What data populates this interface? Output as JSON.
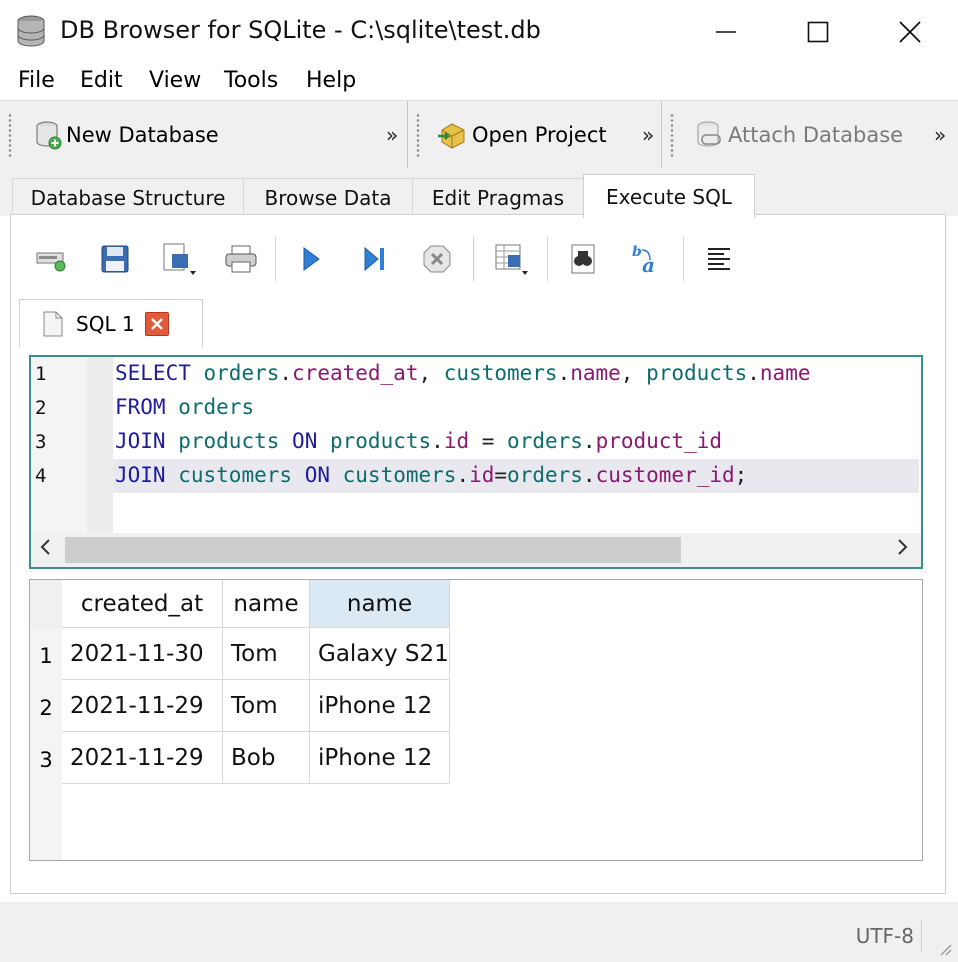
{
  "window": {
    "title": "DB Browser for SQLite - C:\\sqlite\\test.db"
  },
  "menu": [
    {
      "label": "File"
    },
    {
      "label": "Edit"
    },
    {
      "label": "View"
    },
    {
      "label": "Tools"
    },
    {
      "label": "Help"
    }
  ],
  "toolbar": {
    "new_database": "New Database",
    "open_project": "Open Project",
    "attach_database": "Attach Database",
    "more": "»"
  },
  "tabs": [
    {
      "label": "Database Structure"
    },
    {
      "label": "Browse Data"
    },
    {
      "label": "Edit Pragmas"
    },
    {
      "label": "Execute SQL"
    }
  ],
  "sql_tab": {
    "label": "SQL 1"
  },
  "editor": {
    "line_numbers": [
      "1",
      "2",
      "3",
      "4"
    ],
    "lines": [
      [
        [
          "kw",
          "SELECT"
        ],
        [
          "pn",
          " "
        ],
        [
          "id",
          "orders"
        ],
        [
          "pn",
          "."
        ],
        [
          "fld",
          "created_at"
        ],
        [
          "pn",
          ", "
        ],
        [
          "id",
          "customers"
        ],
        [
          "pn",
          "."
        ],
        [
          "fld",
          "name"
        ],
        [
          "pn",
          ", "
        ],
        [
          "id",
          "products"
        ],
        [
          "pn",
          "."
        ],
        [
          "fld",
          "name"
        ]
      ],
      [
        [
          "kw",
          "FROM"
        ],
        [
          "pn",
          " "
        ],
        [
          "id",
          "orders"
        ]
      ],
      [
        [
          "kw",
          "JOIN"
        ],
        [
          "pn",
          " "
        ],
        [
          "id",
          "products"
        ],
        [
          "pn",
          " "
        ],
        [
          "kw",
          "ON"
        ],
        [
          "pn",
          " "
        ],
        [
          "id",
          "products"
        ],
        [
          "pn",
          "."
        ],
        [
          "fld",
          "id"
        ],
        [
          "pn",
          " = "
        ],
        [
          "id",
          "orders"
        ],
        [
          "pn",
          "."
        ],
        [
          "fld",
          "product_id"
        ]
      ],
      [
        [
          "kw",
          "JOIN"
        ],
        [
          "pn",
          " "
        ],
        [
          "id",
          "customers"
        ],
        [
          "pn",
          " "
        ],
        [
          "kw",
          "ON"
        ],
        [
          "pn",
          " "
        ],
        [
          "id",
          "customers"
        ],
        [
          "pn",
          "."
        ],
        [
          "fld",
          "id"
        ],
        [
          "pn",
          "="
        ],
        [
          "id",
          "orders"
        ],
        [
          "pn",
          "."
        ],
        [
          "fld",
          "customer_id"
        ],
        [
          "pn",
          ";"
        ]
      ]
    ]
  },
  "results": {
    "columns": [
      "created_at",
      "name",
      "name"
    ],
    "rows": [
      {
        "num": "1",
        "cells": [
          "2021-11-30",
          "Tom",
          "Galaxy S21"
        ]
      },
      {
        "num": "2",
        "cells": [
          "2021-11-29",
          "Tom",
          "iPhone 12"
        ]
      },
      {
        "num": "3",
        "cells": [
          "2021-11-29",
          "Bob",
          "iPhone 12"
        ]
      }
    ]
  },
  "status": {
    "encoding": "UTF-8"
  },
  "colors": {
    "editor_border": "#3a8e8e",
    "keyword": "#1d1d9b",
    "identifier": "#0e6b6b",
    "field": "#8a1a6f",
    "selected_header": "#dbe9f4"
  }
}
